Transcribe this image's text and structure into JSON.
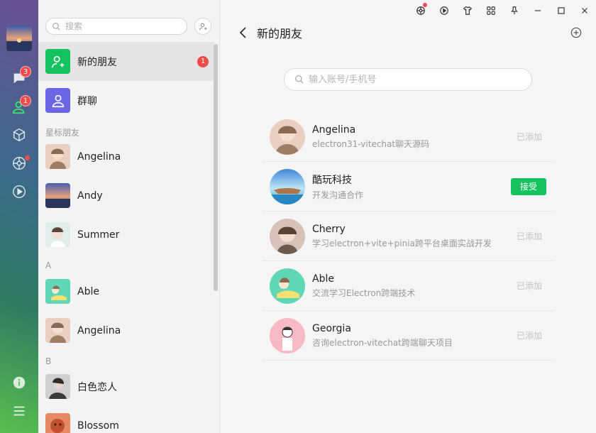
{
  "nav": {
    "chat_badge": "3",
    "contacts_badge": "1",
    "icons": [
      "chat-icon",
      "contacts-icon",
      "cube-icon",
      "moments-icon",
      "video-play-icon",
      "info-icon",
      "menu-icon"
    ]
  },
  "contacts": {
    "search_placeholder": "搜索",
    "new_friends": {
      "label": "新的朋友",
      "badge": "1"
    },
    "group_chat": {
      "label": "群聊"
    },
    "starred_label": "星标朋友",
    "starred": [
      {
        "name": "Angelina"
      },
      {
        "name": "Andy"
      },
      {
        "name": "Summer"
      }
    ],
    "section_a": "A",
    "a_items": [
      {
        "name": "Able"
      },
      {
        "name": "Angelina"
      }
    ],
    "section_b": "B",
    "b_items": [
      {
        "name": "白色恋人"
      },
      {
        "name": "Blossom"
      }
    ]
  },
  "main": {
    "title": "新的朋友",
    "account_search_placeholder": "输入账号/手机号",
    "requests": [
      {
        "name": "Angelina",
        "message": "electron31-vitechat聊天源码",
        "status": "已添加"
      },
      {
        "name": "酷玩科技",
        "message": "开发沟通合作",
        "action": "接受"
      },
      {
        "name": "Cherry",
        "message": "学习electron+vite+pinia跨平台桌面实战开发",
        "status": "已添加"
      },
      {
        "name": "Able",
        "message": "交流学习Electron跨端技术",
        "status": "已添加"
      },
      {
        "name": "Georgia",
        "message": "咨询electron-vitechat跨端聊天项目",
        "status": "已添加"
      }
    ]
  },
  "colors": {
    "accent_green": "#15c260",
    "badge_red": "#f04b4b",
    "group_tile": "#6a66e6"
  }
}
